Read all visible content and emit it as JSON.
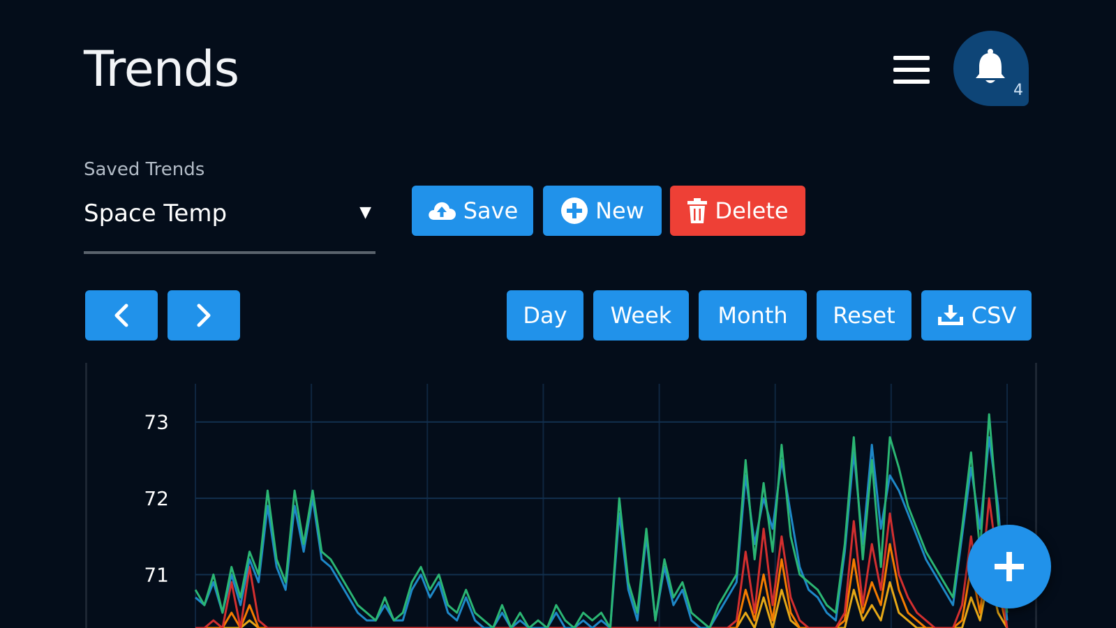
{
  "header": {
    "title": "Trends",
    "notification_count": "4"
  },
  "icons": {
    "menu": "hamburger-icon",
    "notifications": "bell-icon",
    "save": "cloud-upload-icon",
    "new": "plus-circle-icon",
    "delete": "trash-icon",
    "prev": "chevron-left-icon",
    "next": "chevron-right-icon",
    "csv": "download-icon",
    "fab": "plus-icon"
  },
  "saved_trends": {
    "label": "Saved Trends",
    "selected": "Space Temp"
  },
  "actions": {
    "save": "Save",
    "new": "New",
    "delete": "Delete"
  },
  "range_buttons": {
    "day": "Day",
    "week": "Week",
    "month": "Month",
    "reset": "Reset",
    "csv": "CSV"
  },
  "colors": {
    "accent": "#2192ea",
    "danger": "#ee4036",
    "background": "#040d1a",
    "notification_bg": "#0e4577"
  },
  "chart_data": {
    "type": "line",
    "title": "",
    "xlabel": "",
    "ylabel": "",
    "yticks": [
      "73",
      "72",
      "71"
    ],
    "ylim": [
      70.3,
      73.5
    ],
    "grid": true,
    "x": [
      0,
      1,
      2,
      3,
      4,
      5,
      6,
      7,
      8,
      9,
      10,
      11,
      12,
      13,
      14,
      15,
      16,
      17,
      18,
      19,
      20,
      21,
      22,
      23,
      24,
      25,
      26,
      27,
      28,
      29,
      30,
      31,
      32,
      33,
      34,
      35,
      36,
      37,
      38,
      39,
      40,
      41,
      42,
      43,
      44,
      45,
      46,
      47,
      48,
      49,
      50,
      51,
      52,
      53,
      54,
      55,
      56,
      57,
      58,
      59,
      60,
      61,
      62,
      63,
      64,
      65,
      66,
      67,
      68,
      69,
      70,
      71,
      72,
      73,
      74,
      75,
      76,
      77,
      78,
      79,
      80,
      81,
      82,
      83,
      84,
      85,
      86,
      87,
      88,
      89,
      90
    ],
    "series": [
      {
        "color": "#2bb673",
        "values": [
          70.8,
          70.6,
          71.0,
          70.5,
          71.1,
          70.7,
          71.3,
          71.0,
          72.1,
          71.2,
          70.9,
          72.1,
          71.4,
          72.1,
          71.3,
          71.2,
          71.0,
          70.8,
          70.6,
          70.5,
          70.4,
          70.7,
          70.4,
          70.5,
          70.9,
          71.1,
          70.8,
          71.0,
          70.6,
          70.5,
          70.8,
          70.5,
          70.4,
          70.3,
          70.6,
          70.3,
          70.5,
          70.3,
          70.4,
          70.3,
          70.6,
          70.4,
          70.3,
          70.5,
          70.4,
          70.5,
          70.3,
          72.0,
          70.9,
          70.5,
          71.6,
          70.4,
          71.2,
          70.7,
          70.9,
          70.5,
          70.4,
          70.3,
          70.6,
          70.8,
          71.0,
          72.5,
          71.2,
          72.2,
          71.3,
          72.7,
          71.5,
          71.0,
          70.9,
          70.8,
          70.6,
          70.5,
          71.4,
          72.8,
          71.2,
          72.5,
          71.1,
          72.8,
          72.4,
          71.9,
          71.6,
          71.3,
          71.1,
          70.9,
          70.7,
          71.6,
          72.6,
          71.3,
          73.1,
          71.7,
          70.5
        ]
      },
      {
        "color": "#1e88c8",
        "values": [
          70.7,
          70.6,
          70.9,
          70.5,
          71.0,
          70.6,
          71.2,
          70.9,
          71.9,
          71.1,
          70.8,
          71.9,
          71.3,
          72.0,
          71.2,
          71.1,
          70.9,
          70.7,
          70.5,
          70.4,
          70.4,
          70.6,
          70.4,
          70.4,
          70.8,
          71.0,
          70.7,
          70.9,
          70.5,
          70.4,
          70.7,
          70.4,
          70.3,
          70.3,
          70.5,
          70.3,
          70.4,
          70.3,
          70.3,
          70.3,
          70.5,
          70.3,
          70.3,
          70.4,
          70.3,
          70.4,
          70.3,
          71.8,
          70.8,
          70.4,
          71.5,
          70.4,
          71.1,
          70.6,
          70.8,
          70.4,
          70.3,
          70.3,
          70.5,
          70.7,
          70.9,
          72.3,
          71.4,
          72.0,
          71.6,
          72.5,
          71.8,
          71.1,
          70.8,
          70.7,
          70.5,
          70.4,
          71.3,
          72.6,
          71.4,
          72.7,
          71.6,
          72.3,
          72.1,
          71.8,
          71.5,
          71.2,
          71.0,
          70.8,
          70.6,
          71.5,
          72.4,
          71.6,
          72.8,
          71.9,
          70.4
        ]
      },
      {
        "color": "#d32f2f",
        "values": [
          70.3,
          70.3,
          70.4,
          70.3,
          70.9,
          70.3,
          71.1,
          70.4,
          70.3,
          70.3,
          70.3,
          70.3,
          70.3,
          70.3,
          70.3,
          70.3,
          70.3,
          70.3,
          70.3,
          70.3,
          70.3,
          70.3,
          70.3,
          70.3,
          70.3,
          70.3,
          70.3,
          70.3,
          70.3,
          70.3,
          70.3,
          70.3,
          70.3,
          70.3,
          70.3,
          70.3,
          70.3,
          70.3,
          70.3,
          70.3,
          70.3,
          70.3,
          70.3,
          70.3,
          70.3,
          70.3,
          70.3,
          70.3,
          70.3,
          70.3,
          70.3,
          70.3,
          70.3,
          70.3,
          70.3,
          70.3,
          70.3,
          70.3,
          70.3,
          70.3,
          70.4,
          71.3,
          70.5,
          71.6,
          70.6,
          71.5,
          70.7,
          70.4,
          70.3,
          70.3,
          70.3,
          70.3,
          70.5,
          71.7,
          70.6,
          71.4,
          70.8,
          71.8,
          71.0,
          70.7,
          70.5,
          70.4,
          70.3,
          70.3,
          70.3,
          70.6,
          71.5,
          70.7,
          72.0,
          71.1,
          70.3
        ]
      },
      {
        "color": "#f57c00",
        "values": [
          70.3,
          70.3,
          70.3,
          70.3,
          70.5,
          70.3,
          70.6,
          70.3,
          70.3,
          70.3,
          70.3,
          70.3,
          70.3,
          70.3,
          70.3,
          70.3,
          70.3,
          70.3,
          70.3,
          70.3,
          70.3,
          70.3,
          70.3,
          70.3,
          70.3,
          70.3,
          70.3,
          70.3,
          70.3,
          70.3,
          70.3,
          70.3,
          70.3,
          70.3,
          70.3,
          70.3,
          70.3,
          70.3,
          70.3,
          70.3,
          70.3,
          70.3,
          70.3,
          70.3,
          70.3,
          70.3,
          70.3,
          70.3,
          70.3,
          70.3,
          70.3,
          70.3,
          70.3,
          70.3,
          70.3,
          70.3,
          70.3,
          70.3,
          70.3,
          70.3,
          70.3,
          70.8,
          70.4,
          71.0,
          70.4,
          71.2,
          70.5,
          70.3,
          70.3,
          70.3,
          70.3,
          70.3,
          70.4,
          71.2,
          70.5,
          70.9,
          70.6,
          71.4,
          70.8,
          70.5,
          70.4,
          70.3,
          70.3,
          70.3,
          70.3,
          70.4,
          71.1,
          70.5,
          71.5,
          70.8,
          70.3
        ]
      },
      {
        "color": "#e6a817",
        "values": [
          70.3,
          70.3,
          70.3,
          70.3,
          70.3,
          70.3,
          70.4,
          70.3,
          70.3,
          70.3,
          70.3,
          70.3,
          70.3,
          70.3,
          70.3,
          70.3,
          70.3,
          70.3,
          70.3,
          70.3,
          70.3,
          70.3,
          70.3,
          70.3,
          70.3,
          70.3,
          70.3,
          70.3,
          70.3,
          70.3,
          70.3,
          70.3,
          70.3,
          70.3,
          70.3,
          70.3,
          70.3,
          70.3,
          70.3,
          70.3,
          70.3,
          70.3,
          70.3,
          70.3,
          70.3,
          70.3,
          70.3,
          70.3,
          70.3,
          70.3,
          70.3,
          70.3,
          70.3,
          70.3,
          70.3,
          70.3,
          70.3,
          70.3,
          70.3,
          70.3,
          70.3,
          70.5,
          70.3,
          70.7,
          70.3,
          70.8,
          70.4,
          70.3,
          70.3,
          70.3,
          70.3,
          70.3,
          70.3,
          70.8,
          70.4,
          70.6,
          70.4,
          70.9,
          70.5,
          70.4,
          70.3,
          70.3,
          70.3,
          70.3,
          70.3,
          70.3,
          70.7,
          70.4,
          71.0,
          70.5,
          70.3
        ]
      }
    ]
  }
}
